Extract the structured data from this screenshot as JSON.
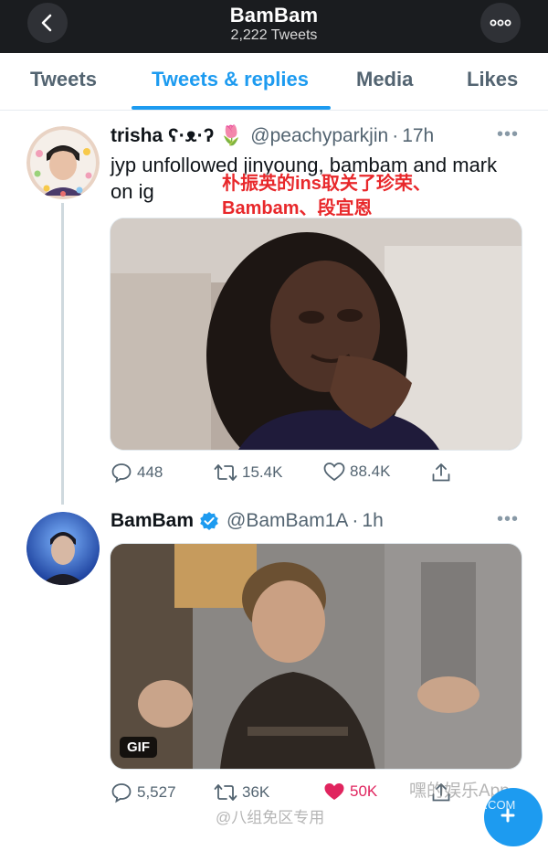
{
  "header": {
    "title": "BamBam",
    "subtitle": "2,222 Tweets"
  },
  "tabs": [
    {
      "label": "Tweets",
      "active": false
    },
    {
      "label": "Tweets & replies",
      "active": true
    },
    {
      "label": "Media",
      "active": false
    },
    {
      "label": "Likes",
      "active": false
    }
  ],
  "tweets": [
    {
      "name": "trisha ʕ·ᴥ·ʔ 🌷",
      "handle": "@peachyparkjin",
      "dot": "·",
      "time": "17h",
      "text": "jyp unfollowed jinyoung, bambam and mark on ig",
      "overlay_text": "朴振英的ins取关了珍荣、Bambam、段宜恩",
      "media_type": "image",
      "replies": "448",
      "retweets": "15.4K",
      "likes": "88.4K"
    },
    {
      "name": "BamBam",
      "handle": "@BamBam1A",
      "dot": "·",
      "time": "1h",
      "verified": true,
      "media_type": "gif",
      "media_badge": "GIF",
      "replies": "5,527",
      "retweets": "36K",
      "likes": "50K",
      "liked": true
    }
  ],
  "watermarks": {
    "weibo": "@八组免区专用",
    "brand": "嘿的娱乐App",
    "site": "JUZI.COM"
  },
  "colors": {
    "accent": "#1d9bf0",
    "like": "#e0245e",
    "header_bg": "#1a1c1f"
  }
}
